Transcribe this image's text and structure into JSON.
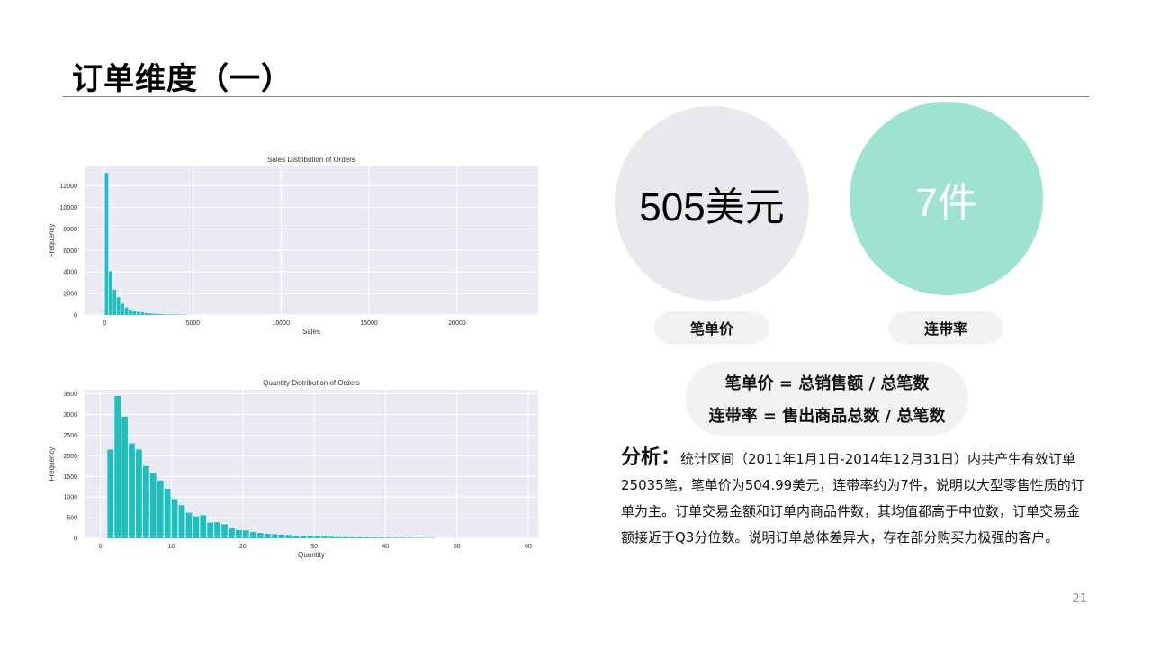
{
  "slide": {
    "title": "订单维度（一）",
    "page_number": "21"
  },
  "metrics": {
    "avg_order_value": {
      "value": "505美元",
      "label": "笔单价"
    },
    "units_per_transaction": {
      "value": "7件",
      "label": "连带率"
    }
  },
  "formulas": [
    "笔单价 = 总销售额 / 总笔数",
    "连带率 = 售出商品总数 / 总笔数"
  ],
  "analysis": {
    "label": "分析：",
    "text": "统计区间（2011年1月1日-2014年12月31日）内共产生有效订单25035笔，笔单价为504.99美元，连带率约为7件，说明以大型零售性质的订单为主。订单交易金额和订单内商品件数，其均值都高于中位数，订单交易金额接近于Q3分位数。说明订单总体差异大，存在部分购买力极强的客户。"
  },
  "colors": {
    "bar": "#1ebfbf",
    "plot_bg": "#eaeaf2",
    "price_circle": "#e8e9ec",
    "upt_circle": "#9de3cf"
  },
  "chart_data": [
    {
      "type": "bar",
      "title": "Sales Distribution of Orders",
      "xlabel": "Sales",
      "ylabel": "Frequency",
      "xlim": [
        -1150,
        24600
      ],
      "ylim": [
        0,
        13800
      ],
      "xticks": [
        0,
        5000,
        10000,
        15000,
        20000
      ],
      "yticks": [
        0,
        2000,
        4000,
        6000,
        8000,
        10000,
        12000
      ],
      "grid": true,
      "bin_width": 226,
      "x": [
        0,
        226,
        452,
        678,
        904,
        1130,
        1356,
        1582,
        1808,
        2034,
        2260,
        2486,
        2712,
        2938,
        3164,
        3390,
        3616,
        3842,
        4068,
        4294,
        4520
      ],
      "values": [
        13200,
        4050,
        2350,
        1650,
        1050,
        700,
        520,
        380,
        300,
        240,
        180,
        140,
        110,
        90,
        70,
        60,
        50,
        40,
        35,
        30,
        25
      ]
    },
    {
      "type": "bar",
      "title": "Quantity Distribution of Orders",
      "xlabel": "Quantity",
      "ylabel": "Frequency",
      "xlim": [
        -2.2,
        61.4
      ],
      "ylim": [
        0,
        3600
      ],
      "xticks": [
        0,
        10,
        20,
        30,
        40,
        50,
        60
      ],
      "yticks": [
        0,
        500,
        1000,
        1500,
        2000,
        2500,
        3000,
        3500
      ],
      "grid": true,
      "bin_width": 1,
      "x": [
        1,
        2,
        3,
        4,
        5,
        6,
        7,
        8,
        9,
        10,
        11,
        12,
        13,
        14,
        15,
        16,
        17,
        18,
        19,
        20,
        21,
        22,
        23,
        24,
        25,
        26,
        27,
        28,
        29,
        30,
        31,
        32,
        33,
        34,
        35,
        36,
        37,
        38,
        39,
        40,
        41,
        42,
        43,
        44,
        45,
        46
      ],
      "values": [
        2150,
        3450,
        2950,
        2300,
        2150,
        1750,
        1580,
        1400,
        1200,
        950,
        800,
        620,
        530,
        560,
        380,
        390,
        340,
        240,
        200,
        190,
        150,
        130,
        110,
        100,
        90,
        80,
        60,
        55,
        50,
        45,
        40,
        35,
        30,
        28,
        25,
        22,
        20,
        18,
        15,
        15,
        12,
        12,
        10,
        10,
        8,
        8
      ]
    }
  ]
}
